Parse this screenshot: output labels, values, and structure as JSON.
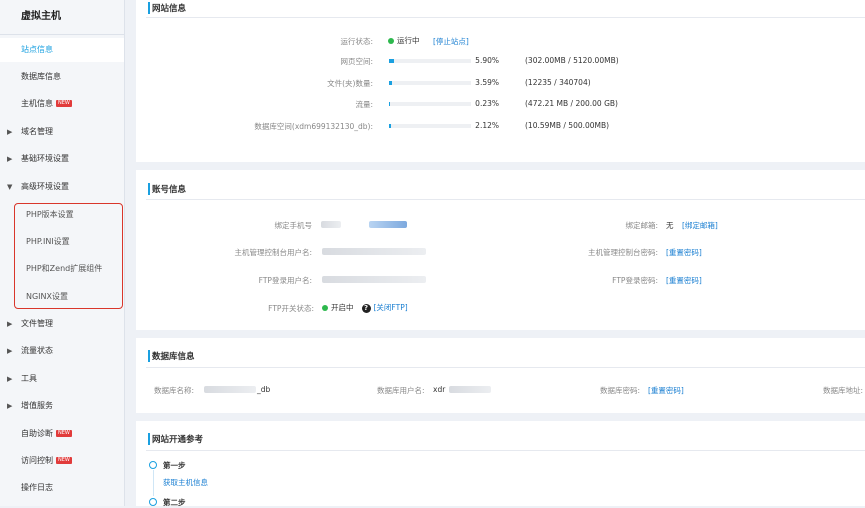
{
  "sidebar": {
    "title": "虚拟主机",
    "items": [
      {
        "label": "站点信息",
        "active": true
      },
      {
        "label": "数据库信息"
      },
      {
        "label": "主机信息",
        "badge": "NEW"
      },
      {
        "label": "域名管理",
        "caret": "▶"
      },
      {
        "label": "基础环境设置",
        "caret": "▶"
      },
      {
        "label": "高级环境设置",
        "caret": "▼"
      },
      {
        "label": "PHP版本设置"
      },
      {
        "label": "PHP.INI设置"
      },
      {
        "label": "PHP和Zend扩展组件"
      },
      {
        "label": "NGINX设置"
      },
      {
        "label": "文件管理",
        "caret": "▶"
      },
      {
        "label": "流量状态",
        "caret": "▶"
      },
      {
        "label": "工具",
        "caret": "▶"
      },
      {
        "label": "增值服务",
        "caret": "▶"
      },
      {
        "label": "自助诊断",
        "badge": "NEW"
      },
      {
        "label": "访问控制",
        "badge": "NEW"
      },
      {
        "label": "操作日志"
      }
    ]
  },
  "site_info": {
    "title": "网站信息",
    "run_status_label": "运行状态:",
    "run_status_value": "运行中",
    "stop_link": "[停止站点]",
    "rows": [
      {
        "label": "网页空间:",
        "percent": "5.90%",
        "fraction": 0.059,
        "detail": "(302.00MB / 5120.00MB)"
      },
      {
        "label": "文件(夹)数量:",
        "percent": "3.59%",
        "fraction": 0.0359,
        "detail": "(12235 / 340704)"
      },
      {
        "label": "流量:",
        "percent": "0.23%",
        "fraction": 0.0023,
        "detail": "(472.21 MB / 200.00 GB)"
      },
      {
        "label": "数据库空间(xdm699132130_db):",
        "percent": "2.12%",
        "fraction": 0.0212,
        "detail": "(10.59MB / 500.00MB)"
      }
    ]
  },
  "account_info": {
    "title": "账号信息",
    "phone_label": "绑定手机号",
    "email_label": "绑定邮箱:",
    "email_value": "无",
    "email_link": "[绑定邮箱]",
    "panel_user_label": "主机管理控制台用户名:",
    "panel_pwd_label": "主机管理控制台密码:",
    "panel_pwd_link": "[重置密码]",
    "ftp_user_label": "FTP登录用户名:",
    "ftp_pwd_label": "FTP登录密码:",
    "ftp_pwd_link": "[重置密码]",
    "ftp_switch_label": "FTP开关状态:",
    "ftp_switch_value": "开启中",
    "ftp_switch_link": "[关闭FTP]"
  },
  "db_info": {
    "title": "数据库信息",
    "name_label": "数据库名称:",
    "name_tail": "_db",
    "user_label": "数据库用户名:",
    "user_value": "xdr",
    "pwd_label": "数据库密码:",
    "pwd_link": "[重置密码]",
    "addr_label": "数据库地址:"
  },
  "ref": {
    "title": "网站开通参考",
    "step1": "第一步",
    "step1_link": "获取主机信息",
    "step2": "第二步"
  },
  "colors": {
    "accent": "#1aa0e0",
    "link": "#1a7fd2",
    "running": "#2db84d",
    "highlight": "#d9362b",
    "badge": "#e13b3b"
  }
}
